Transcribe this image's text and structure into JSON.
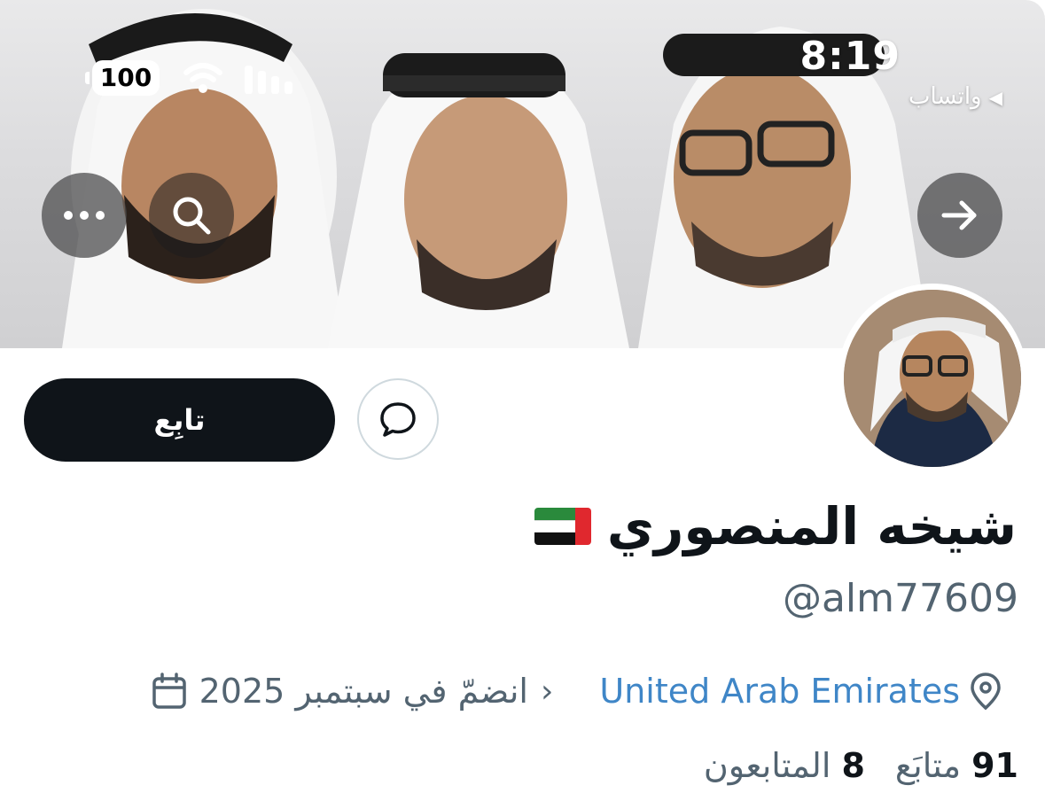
{
  "status_bar": {
    "time": "8:19",
    "back_app": "واتساب",
    "battery": "100"
  },
  "profile": {
    "display_name": "شيخه المنصوري",
    "handle": "@alm77609",
    "location": "United Arab Emirates",
    "joined": "انضمّ في سبتمبر 2025",
    "following_count": "91",
    "following_label": "متابَع",
    "followers_count": "8",
    "followers_label": "المتابعون"
  },
  "actions": {
    "follow_label": "تابِع"
  },
  "icons": {
    "more": "more-horizontal-icon",
    "search": "search-icon",
    "forward": "arrow-right-icon",
    "message": "message-bubble-icon",
    "location": "location-pin-icon",
    "calendar": "calendar-icon"
  },
  "colors": {
    "link": "#3f86c7",
    "text_primary": "#0f1419",
    "text_secondary": "#536471"
  }
}
